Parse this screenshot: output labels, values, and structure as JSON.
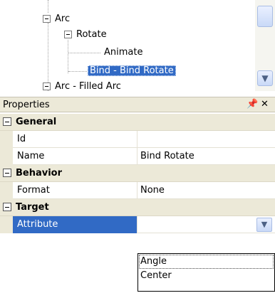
{
  "tree": {
    "nodes": [
      {
        "label": "Arc"
      },
      {
        "label": "Rotate"
      },
      {
        "label": "Animate"
      },
      {
        "label": "Bind - Bind Rotate"
      },
      {
        "label": "Arc - Filled Arc"
      }
    ],
    "selected_color": "#316ac5"
  },
  "properties": {
    "title": "Properties",
    "pin_icon": "pin-icon",
    "close_icon": "close-icon",
    "categories": [
      {
        "label": "General",
        "rows": [
          {
            "name": "Id",
            "value": ""
          },
          {
            "name": "Name",
            "value": "Bind Rotate"
          }
        ]
      },
      {
        "label": "Behavior",
        "rows": [
          {
            "name": "Format",
            "value": "None"
          }
        ]
      },
      {
        "label": "Target",
        "rows": [
          {
            "name": "Attribute",
            "value": ""
          }
        ]
      }
    ],
    "attribute_options": [
      "Angle",
      "Center"
    ]
  }
}
